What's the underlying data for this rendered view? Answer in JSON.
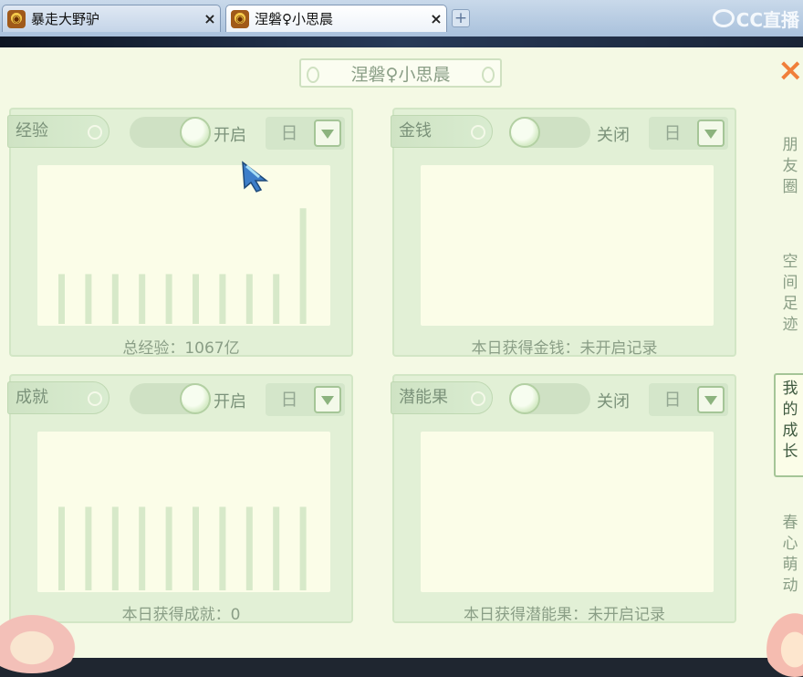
{
  "browser": {
    "tabs": [
      {
        "title": "暴走大野驴",
        "close": "×"
      },
      {
        "title": "涅磐♀小思晨",
        "close": "×"
      }
    ],
    "new_tab": "+",
    "brand": "CC直播"
  },
  "window": {
    "title": "涅磐♀小思晨",
    "close": "×"
  },
  "cards": [
    {
      "label": "经验",
      "toggle": "开启",
      "toggle_on": true,
      "period": "日",
      "footer": "总经验：1067亿",
      "bars": [
        0.31,
        0.31,
        0.31,
        0.31,
        0.31,
        0.31,
        0.31,
        0.31,
        0.31,
        0.72
      ]
    },
    {
      "label": "金钱",
      "toggle": "关闭",
      "toggle_on": false,
      "period": "日",
      "footer": "本日获得金钱：未开启记录",
      "bars": []
    },
    {
      "label": "成就",
      "toggle": "开启",
      "toggle_on": true,
      "period": "日",
      "footer": "本日获得成就：0",
      "bars": [
        0.52,
        0.52,
        0.52,
        0.52,
        0.52,
        0.52,
        0.52,
        0.52,
        0.52,
        0.52
      ]
    },
    {
      "label": "潜能果",
      "toggle": "关闭",
      "toggle_on": false,
      "period": "日",
      "footer": "本日获得潜能果：未开启记录",
      "bars": []
    }
  ],
  "side_tabs": [
    {
      "label": "朋友圈",
      "active": false
    },
    {
      "label": "空间足迹",
      "active": false
    },
    {
      "label": "我的成长",
      "active": true
    },
    {
      "label": "春心萌动",
      "active": false
    }
  ],
  "colors": {
    "panel_bg": "#f4f9e4",
    "card_bg": "#e2f0d6",
    "bar": "#d7e9c9",
    "close_accent": "#f07f3a"
  }
}
